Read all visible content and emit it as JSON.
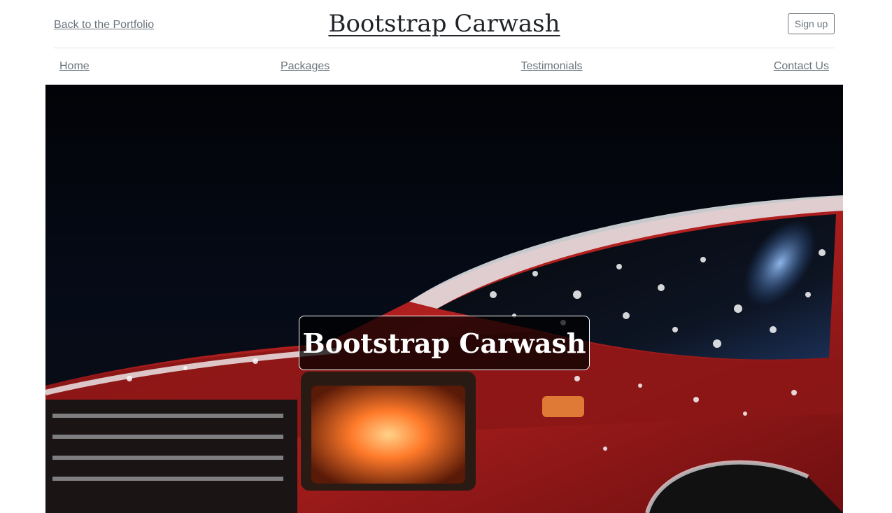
{
  "header": {
    "portfolio_link": "Back to the Portfolio",
    "site_title": "Bootstrap Carwash",
    "signup_label": "Sign up"
  },
  "nav": {
    "items": [
      {
        "label": "Home"
      },
      {
        "label": "Packages"
      },
      {
        "label": "Testimonials"
      },
      {
        "label": "Contact Us"
      }
    ]
  },
  "hero": {
    "title": "Bootstrap Carwash",
    "image_subject": "red car covered in soap foam at night"
  },
  "colors": {
    "link_gray": "#6c757d",
    "text_dark": "#212529",
    "car_red": "#b3201f",
    "hero_dark": "#050a16"
  }
}
